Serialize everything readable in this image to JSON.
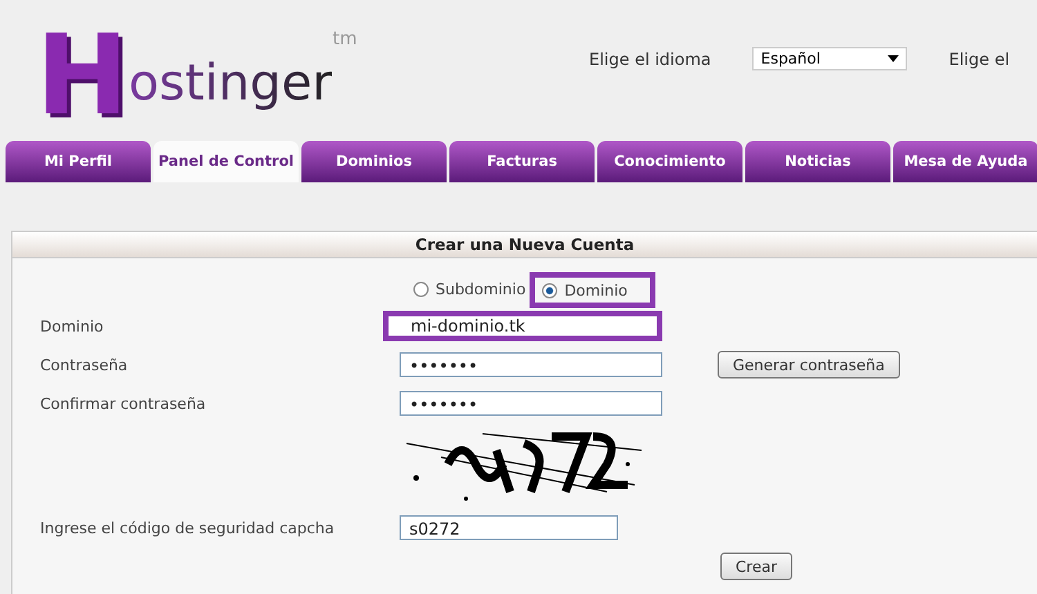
{
  "logo": {
    "initial": "H",
    "rest": "ostinger",
    "trademark": "tm"
  },
  "language": {
    "label": "Elige el idioma",
    "value": "Español",
    "label_2": "Elige el"
  },
  "tabs": [
    {
      "label": "Mi Perfil",
      "selected": false
    },
    {
      "label": "Panel de Control",
      "selected": true
    },
    {
      "label": "Dominios",
      "selected": false
    },
    {
      "label": "Facturas",
      "selected": false
    },
    {
      "label": "Conocimiento",
      "selected": false
    },
    {
      "label": "Noticias",
      "selected": false
    },
    {
      "label": "Mesa de Ayuda",
      "selected": false
    }
  ],
  "form": {
    "title": "Crear una Nueva Cuenta",
    "radios": [
      {
        "label": "Subdominio",
        "selected": false,
        "highlighted": false
      },
      {
        "label": "Dominio",
        "selected": true,
        "highlighted": true
      }
    ],
    "fields": [
      {
        "label": "Dominio",
        "value": "mi-dominio.tk",
        "highlighted": true
      },
      {
        "label": "Contraseña",
        "value": "•••••••",
        "highlighted": false,
        "button": "Generar contraseña"
      },
      {
        "label": "Confirmar contraseña",
        "value": "•••••••",
        "highlighted": false
      }
    ],
    "captcha": {
      "label": "Ingrese el código de seguridad capcha",
      "value": "s0272"
    },
    "submit": "Crear"
  }
}
